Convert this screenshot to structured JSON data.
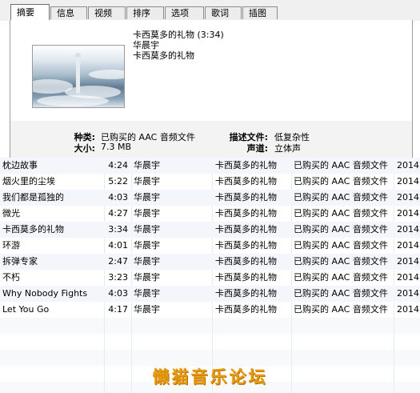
{
  "tabs": [
    "摘要",
    "信息",
    "视频",
    "排序",
    "选项",
    "歌词",
    "插图"
  ],
  "active_tab": "摘要",
  "summary": {
    "title_line": "卡西莫多的礼物 (3:34)",
    "artist": "华晨宇",
    "album": "卡西莫多的礼物",
    "kind_label": "种类:",
    "kind_value": "已购买的 AAC 音频文件",
    "size_label": "大小:",
    "size_value": "7.3 MB",
    "desc_label": "描述文件:",
    "desc_value": "低复杂性",
    "channels_label": "声道:",
    "channels_value": "立体声"
  },
  "tracks": [
    {
      "name": "枕边故事",
      "time": "4:24",
      "artist": "华晨宇",
      "album": "卡西莫多的礼物",
      "kind": "已购买的 AAC 音频文件",
      "year": "2014"
    },
    {
      "name": "烟火里的尘埃",
      "time": "5:22",
      "artist": "华晨宇",
      "album": "卡西莫多的礼物",
      "kind": "已购买的 AAC 音频文件",
      "year": "2014"
    },
    {
      "name": "我们都是孤独的",
      "time": "4:03",
      "artist": "华晨宇",
      "album": "卡西莫多的礼物",
      "kind": "已购买的 AAC 音频文件",
      "year": "2014"
    },
    {
      "name": "微光",
      "time": "4:27",
      "artist": "华晨宇",
      "album": "卡西莫多的礼物",
      "kind": "已购买的 AAC 音频文件",
      "year": "2014"
    },
    {
      "name": "卡西莫多的礼物",
      "time": "3:34",
      "artist": "华晨宇",
      "album": "卡西莫多的礼物",
      "kind": "已购买的 AAC 音频文件",
      "year": "2014"
    },
    {
      "name": "环游",
      "time": "4:01",
      "artist": "华晨宇",
      "album": "卡西莫多的礼物",
      "kind": "已购买的 AAC 音频文件",
      "year": "2014"
    },
    {
      "name": "拆弹专家",
      "time": "2:47",
      "artist": "华晨宇",
      "album": "卡西莫多的礼物",
      "kind": "已购买的 AAC 音频文件",
      "year": "2014"
    },
    {
      "name": "不朽",
      "time": "3:23",
      "artist": "华晨宇",
      "album": "卡西莫多的礼物",
      "kind": "已购买的 AAC 音频文件",
      "year": "2014"
    },
    {
      "name": "Why Nobody Fights",
      "time": "4:03",
      "artist": "华晨宇",
      "album": "卡西莫多的礼物",
      "kind": "已购买的 AAC 音频文件",
      "year": "2014"
    },
    {
      "name": "Let You Go",
      "time": "4:17",
      "artist": "华晨宇",
      "album": "卡西莫多的礼物",
      "kind": "已购买的 AAC 音频文件",
      "year": "2014"
    }
  ],
  "watermark": "懒猫音乐论坛"
}
